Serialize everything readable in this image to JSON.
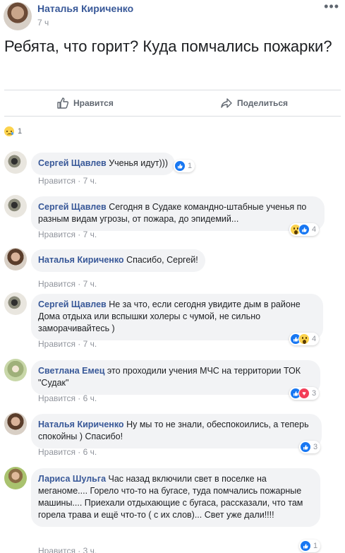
{
  "post": {
    "author": "Наталья Кириченко",
    "time": "7 ч",
    "text": "Ребята, что горит? Куда помчались пожарки?",
    "actions": {
      "like": "Нравится",
      "share": "Поделиться"
    },
    "reactions_count": "1"
  },
  "comments": [
    {
      "name": "Сергей Щавлев",
      "text": "Ученья идут)))",
      "like": "Нравится",
      "time": "7 ч.",
      "reactions": "1",
      "reaction_types": [
        "like"
      ]
    },
    {
      "name": "Сергей Щавлев",
      "text": "Сегодня в Судаке командно-штабные ученья по разным видам угрозы, от пожара, до эпидемий...",
      "like": "Нравится",
      "time": "7 ч.",
      "reactions": "4",
      "reaction_types": [
        "wow",
        "like"
      ]
    },
    {
      "name": "Наталья Кириченко",
      "text": "Спасибо, Сергей!",
      "like": "Нравится",
      "time": "7 ч.",
      "reactions": "",
      "reaction_types": []
    },
    {
      "name": "Сергей Щавлев",
      "text": "Не за что, если сегодня увидите дым в районе Дома отдыха или вспышки холеры с чумой, не сильно заморачивайтесь )",
      "like": "Нравится",
      "time": "7 ч.",
      "reactions": "4",
      "reaction_types": [
        "like",
        "wow"
      ]
    },
    {
      "name": "Светлана Емец",
      "text": "это проходили учения МЧС на территории ТОК \"Судак\"",
      "like": "Нравится",
      "time": "6 ч.",
      "reactions": "3",
      "reaction_types": [
        "like",
        "love"
      ]
    },
    {
      "name": "Наталья Кириченко",
      "text": "Ну мы то не знали, обеспокоились, а теперь спокойны ) Спасибо!",
      "like": "Нравится",
      "time": "6 ч.",
      "reactions": "3",
      "reaction_types": [
        "like"
      ]
    },
    {
      "name": "Лариса Шульга",
      "text": "Час назад включили свет в поселке на меганоме.... Горело что-то на бугасе, туда помчались пожарные машины.... Приехали отдыхающие с бугаса, рассказали, что там горела трава и ещё что-то ( с их слов)... Свет уже дали!!!!",
      "like": "Нравится",
      "time": "3 ч.",
      "reactions": "1",
      "reaction_types": [
        "like"
      ]
    }
  ],
  "icons": {
    "like": "thumbs-up-icon",
    "share": "share-arrow-icon",
    "more": "more-dots-icon"
  },
  "colors": {
    "link": "#385898",
    "meta": "#90949c",
    "bubble": "#f2f3f5",
    "like_blue": "#1877f2"
  }
}
